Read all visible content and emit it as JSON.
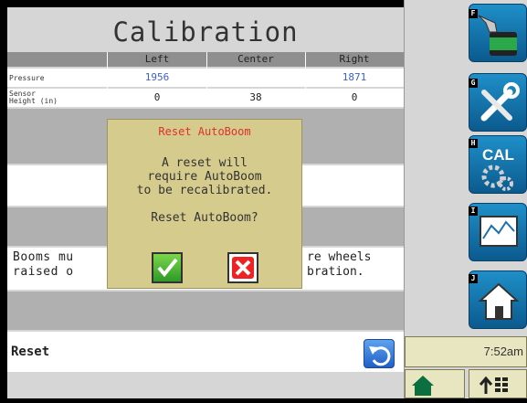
{
  "screen": {
    "title": "Calibration",
    "columns": [
      "Left",
      "Center",
      "Right"
    ],
    "rows": [
      {
        "label": "Pressure",
        "left": "1956",
        "center": "",
        "right": "1871"
      },
      {
        "label_line1": "Sensor",
        "label_line2": "Height (in)",
        "left": "0",
        "center": "38",
        "right": "0"
      }
    ],
    "note_line1": "Booms mu",
    "note_line1_end": "re wheels",
    "note_line2": "raised o",
    "note_line2_end": "bration.",
    "reset_label": "Reset"
  },
  "dialog": {
    "title": "Reset AutoBoom",
    "line1": "A reset will",
    "line2": "require AutoBoom",
    "line3": "to be recalibrated.",
    "question": "Reset AutoBoom?"
  },
  "side_buttons": [
    {
      "letter": "F",
      "icon": "tank-fill-icon"
    },
    {
      "letter": "G",
      "icon": "tools-icon"
    },
    {
      "letter": "H",
      "icon": "calibration-gears-icon",
      "text": "CAL"
    },
    {
      "letter": "I",
      "icon": "chart-monitor-icon"
    },
    {
      "letter": "J",
      "icon": "home-icon"
    }
  ],
  "clock": "7:52am",
  "colors": {
    "accent_blue": "#1f8fc8",
    "dialog_bg": "#d4cb8c",
    "dialog_title": "#e03030",
    "value_blue": "#3a5fc9"
  }
}
